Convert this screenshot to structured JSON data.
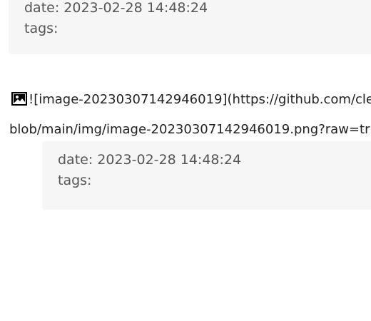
{
  "top_block": {
    "date_line": "date: 2023-02-28 14:48:24",
    "tags_line": "tags:"
  },
  "image_link": {
    "icon": "broken-image-icon",
    "line1": "![image-20230307142946019](https://github.com/cle",
    "line2": "blob/main/img/image-20230307142946019.png?raw=tr"
  },
  "bottom_block": {
    "date_line": "date: 2023-02-28 14:48:24",
    "tags_line": "tags:"
  }
}
